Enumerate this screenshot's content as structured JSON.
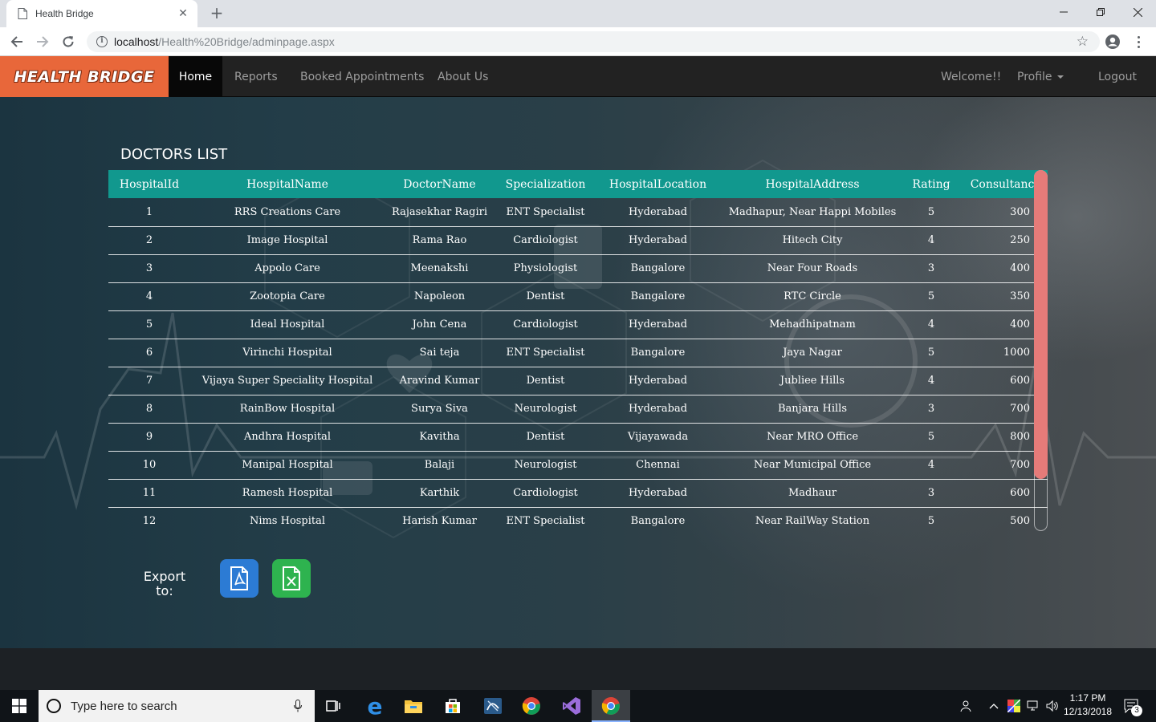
{
  "browser": {
    "tab_title": "Health Bridge",
    "url_host": "localhost",
    "url_path": "/Health%20Bridge/adminpage.aspx"
  },
  "navbar": {
    "brand": "HEALTH BRIDGE",
    "links": [
      "Home",
      "Reports",
      "Booked Appointments",
      "About Us"
    ],
    "welcome": "Welcome!!",
    "profile": "Profile",
    "logout": "Logout"
  },
  "doctors": {
    "title": "DOCTORS LIST",
    "columns": [
      "HospitalId",
      "HospitalName",
      "DoctorName",
      "Specialization",
      "HospitalLocation",
      "HospitalAddress",
      "Rating",
      "Consultancy"
    ],
    "rows": [
      [
        "1",
        "RRS Creations Care",
        "Rajasekhar Ragiri",
        "ENT Specialist",
        "Hyderabad",
        "Madhapur, Near Happi Mobiles",
        "5",
        "300"
      ],
      [
        "2",
        "Image Hospital",
        "Rama Rao",
        "Cardiologist",
        "Hyderabad",
        "Hitech City",
        "4",
        "250"
      ],
      [
        "3",
        "Appolo Care",
        "Meenakshi",
        "Physiologist",
        "Bangalore",
        "Near Four Roads",
        "3",
        "400"
      ],
      [
        "4",
        "Zootopia Care",
        "Napoleon",
        "Dentist",
        "Bangalore",
        "RTC Circle",
        "5",
        "350"
      ],
      [
        "5",
        "Ideal Hospital",
        "John Cena",
        "Cardiologist",
        "Hyderabad",
        "Mehadhipatnam",
        "4",
        "400"
      ],
      [
        "6",
        "Virinchi Hospital",
        "Sai teja",
        "ENT Specialist",
        "Bangalore",
        "Jaya Nagar",
        "5",
        "1000"
      ],
      [
        "7",
        "Vijaya Super Speciality Hospital",
        "Aravind Kumar",
        "Dentist",
        "Hyderabad",
        "Jubliee Hills",
        "4",
        "600"
      ],
      [
        "8",
        "RainBow Hospital",
        "Surya Siva",
        "Neurologist",
        "Hyderabad",
        "Banjara Hills",
        "3",
        "700"
      ],
      [
        "9",
        "Andhra Hospital",
        "Kavitha",
        "Dentist",
        "Vijayawada",
        "Near MRO Office",
        "5",
        "800"
      ],
      [
        "10",
        "Manipal Hospital",
        "Balaji",
        "Neurologist",
        "Chennai",
        "Near Municipal Office",
        "4",
        "700"
      ],
      [
        "11",
        "Ramesh Hospital",
        "Karthik",
        "Cardiologist",
        "Hyderabad",
        "Madhaur",
        "3",
        "600"
      ],
      [
        "12",
        "Nims Hospital",
        "Harish Kumar",
        "ENT Specialist",
        "Bangalore",
        "Near RailWay Station",
        "5",
        "500"
      ]
    ]
  },
  "export": {
    "label": "Export to:",
    "pdf_icon": "pdf-icon",
    "excel_icon": "excel-icon"
  },
  "taskbar": {
    "search_placeholder": "Type here to search",
    "time": "1:17 PM",
    "date": "12/13/2018",
    "notification_count": "3"
  },
  "colors": {
    "brand": "#e8673a",
    "table_header": "#11988e",
    "scrollbar_thumb": "#e67b79",
    "pdf_button": "#2c7bd4",
    "excel_button": "#2eb34f"
  }
}
